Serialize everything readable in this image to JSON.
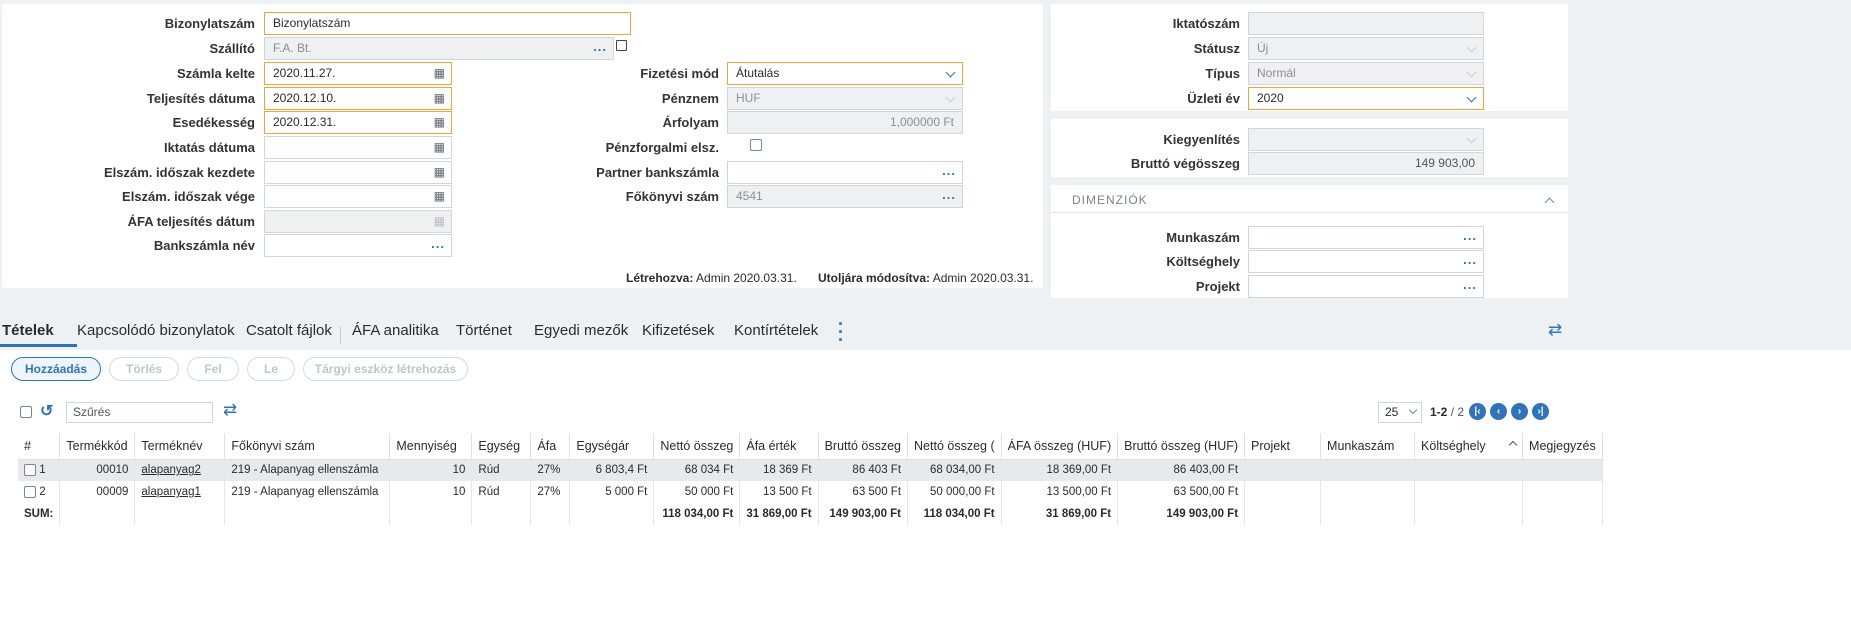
{
  "form": {
    "left": [
      {
        "label": "Bizonylatszám",
        "value": "Bizonylatszám"
      },
      {
        "label": "Szállító",
        "value": "F.A. Bt."
      },
      {
        "label": "Számla kelte",
        "value": "2020.11.27."
      },
      {
        "label": "Teljesítés dátuma",
        "value": "2020.12.10."
      },
      {
        "label": "Esedékesség",
        "value": "2020.12.31."
      },
      {
        "label": "Iktatás dátuma",
        "value": ""
      },
      {
        "label": "Elszám. időszak kezdete",
        "value": ""
      },
      {
        "label": "Elszám. időszak vége",
        "value": ""
      },
      {
        "label": "ÁFA teljesítés dátum",
        "value": ""
      },
      {
        "label": "Bankszámla név",
        "value": ""
      }
    ],
    "mid": [
      {
        "label": "Fizetési mód",
        "value": "Átutalás"
      },
      {
        "label": "Pénznem",
        "value": "HUF"
      },
      {
        "label": "Árfolyam",
        "value": "1,000000 Ft"
      },
      {
        "label": "Pénzforgalmi elsz.",
        "value": ""
      },
      {
        "label": "Partner bankszámla",
        "value": ""
      },
      {
        "label": "Főkönyvi szám",
        "value": "4541"
      }
    ],
    "created_label": "Létrehozva:",
    "created_value": "Admin 2020.03.31.",
    "modified_label": "Utoljára módosítva:",
    "modified_value": "Admin 2020.03.31."
  },
  "right_top": [
    {
      "label": "Iktatószám",
      "value": ""
    },
    {
      "label": "Státusz",
      "value": "Új"
    },
    {
      "label": "Típus",
      "value": "Normál"
    },
    {
      "label": "Üzleti év",
      "value": "2020"
    }
  ],
  "right_mid": [
    {
      "label": "Kiegyenlítés",
      "value": ""
    },
    {
      "label": "Bruttó végösszeg",
      "value": "149 903,00"
    }
  ],
  "dimensions": {
    "title": "DIMENZIÓK",
    "rows": [
      {
        "label": "Munkaszám",
        "value": ""
      },
      {
        "label": "Költséghely",
        "value": ""
      },
      {
        "label": "Projekt",
        "value": ""
      }
    ]
  },
  "tabs": [
    "Tételek",
    "Kapcsolódó bizonylatok",
    "Csatolt fájlok",
    "ÁFA analitika",
    "Történet",
    "Egyedi mezők",
    "Kifizetések",
    "Kontírtételek"
  ],
  "toolbar": {
    "add": "Hozzáadás",
    "delete": "Törlés",
    "up": "Fel",
    "down": "Le",
    "asset": "Tárgyi eszköz létrehozás",
    "filter_placeholder": "Szűrés"
  },
  "pager": {
    "page_size": "25",
    "range": "1-2",
    "total": "/ 2"
  },
  "grid": {
    "headers": [
      "#",
      "Termékkód",
      "Terméknév",
      "Főkönyvi szám",
      "Mennyiség",
      "Egység",
      "Áfa",
      "Egységár",
      "Nettó összeg",
      "Áfa érték",
      "Bruttó összeg",
      "Nettó összeg (",
      "ÁFA összeg (HUF)",
      "Bruttó összeg (HUF)",
      "Projekt",
      "Munkaszám",
      "Költséghely",
      "Megjegyzés"
    ],
    "rows": [
      [
        "1",
        "00010",
        "alapanyag2",
        "219 - Alapanyag ellenszámla",
        "10",
        "Rúd",
        "27%",
        "6 803,4 Ft",
        "68 034 Ft",
        "18 369 Ft",
        "86 403 Ft",
        "68 034,00 Ft",
        "18 369,00 Ft",
        "86 403,00 Ft",
        "",
        "",
        "",
        ""
      ],
      [
        "2",
        "00009",
        "alapanyag1",
        "219 - Alapanyag ellenszámla",
        "10",
        "Rúd",
        "27%",
        "5 000 Ft",
        "50 000 Ft",
        "13 500 Ft",
        "63 500 Ft",
        "50 000,00 Ft",
        "13 500,00 Ft",
        "63 500,00 Ft",
        "",
        "",
        "",
        ""
      ]
    ],
    "sum": [
      "SUM:",
      "",
      "",
      "",
      "",
      "",
      "",
      "",
      "118 034,00 Ft",
      "31 869,00 Ft",
      "149 903,00 Ft",
      "118 034,00 Ft",
      "31 869,00 Ft",
      "149 903,00 Ft",
      "",
      "",
      "",
      ""
    ]
  }
}
